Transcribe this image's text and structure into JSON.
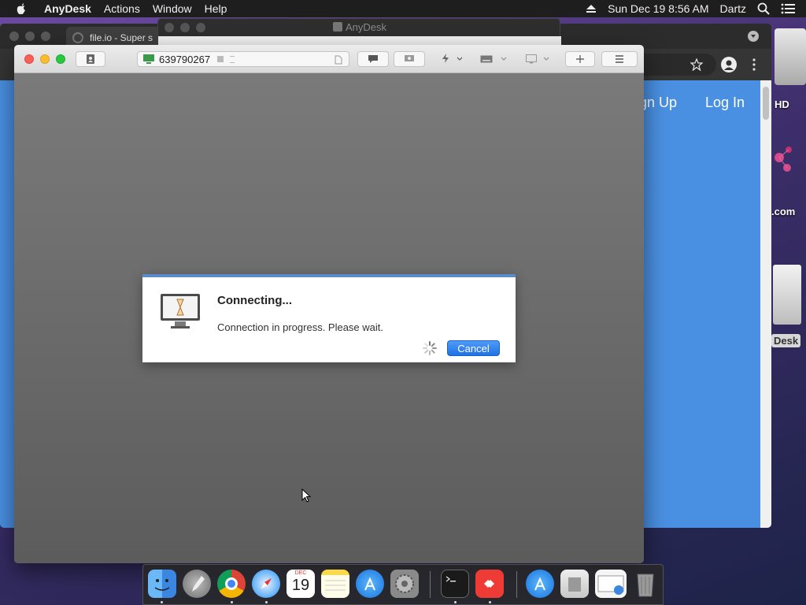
{
  "menubar": {
    "app_name": "AnyDesk",
    "menus": [
      "Actions",
      "Window",
      "Help"
    ],
    "datetime": "Sun Dec 19  8:56 AM",
    "user": "Dartz"
  },
  "desktop": {
    "icon_labels": [
      "HD",
      ".com",
      "Desk"
    ]
  },
  "background_browser": {
    "tab_title": "file.io - Super s",
    "nav_links": [
      "gn Up",
      "Log In"
    ]
  },
  "anydesk_main": {
    "title": "AnyDesk"
  },
  "session": {
    "remote_id": "639790267",
    "dialog": {
      "title": "Connecting...",
      "message": "Connection in progress. Please wait.",
      "cancel_label": "Cancel"
    }
  },
  "dock": {
    "calendar_month": "DEC",
    "calendar_day": "19",
    "apps": [
      "finder",
      "launchpad",
      "chrome",
      "safari",
      "calendar",
      "notes",
      "app-store",
      "system-preferences",
      "terminal",
      "anydesk",
      "applications",
      "documents",
      "preview",
      "trash"
    ]
  },
  "colors": {
    "accent": "#1f72e6",
    "dialog_border": "#5b8cc9",
    "page_blue": "#4a90e2",
    "anydesk_red": "#ef3b36"
  }
}
